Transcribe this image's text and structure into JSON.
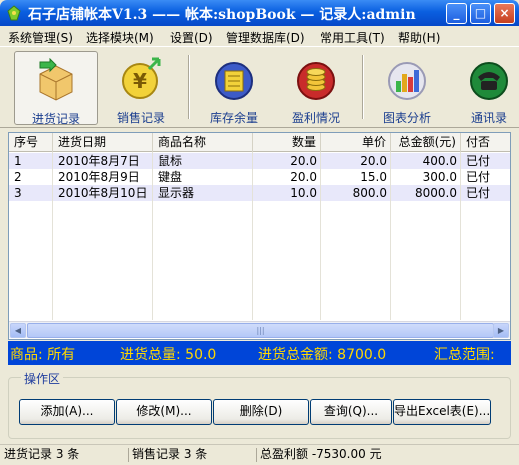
{
  "window": {
    "title": "石子店铺帐本V1.3 —— 帐本:shopBook — 记录人:admin",
    "minimize": "_",
    "maximize": "□",
    "close": "×"
  },
  "menu": [
    "系统管理(S)",
    "选择模块(M)",
    "设置(D)",
    "管理数据库(D)",
    "常用工具(T)",
    "帮助(H)"
  ],
  "toolbar": [
    {
      "label": "进货记录",
      "icon": "purchase-box-icon",
      "active": true
    },
    {
      "label": "销售记录",
      "icon": "sales-yen-icon",
      "active": false
    },
    {
      "label": "库存余量",
      "icon": "inventory-icon",
      "active": false
    },
    {
      "label": "盈利情况",
      "icon": "profit-coins-icon",
      "active": false
    },
    {
      "label": "图表分析",
      "icon": "chart-icon",
      "active": false
    },
    {
      "label": "通讯录",
      "icon": "phone-icon",
      "active": false
    }
  ],
  "table": {
    "columns": [
      "序号",
      "进货日期",
      "商品名称",
      "数量",
      "单价",
      "总金额(元)",
      "付否"
    ],
    "rows": [
      [
        "1",
        "2010年8月7日",
        "鼠标",
        "20.0",
        "20.0",
        "400.0",
        "已付"
      ],
      [
        "2",
        "2010年8月9日",
        "键盘",
        "20.0",
        "15.0",
        "300.0",
        "已付"
      ],
      [
        "3",
        "2010年8月10日",
        "显示器",
        "10.0",
        "800.0",
        "8000.0",
        "已付"
      ]
    ],
    "scroll_left": "◀",
    "scroll_right": "▶",
    "scroll_grip": "|||"
  },
  "summary": {
    "goods": "商品: 所有",
    "total_qty": "进货总量: 50.0",
    "total_amount": "进货总金额: 8700.0",
    "range": "汇总范围:"
  },
  "operations": {
    "title": "操作区",
    "buttons": [
      "添加(A)...",
      "修改(M)...",
      "删除(D)",
      "查询(Q)...",
      "导出Excel表(E)..."
    ]
  },
  "status": {
    "purchase": "进货记录 3 条",
    "sales": "销售记录 3 条",
    "profit": "总盈利额 -7530.00 元"
  },
  "colors": {
    "titlebar": "#0a5fe0",
    "summary_bg": "#0045d8",
    "summary_text": "#ffd800",
    "toolbar_label": "#1b3e8f"
  }
}
